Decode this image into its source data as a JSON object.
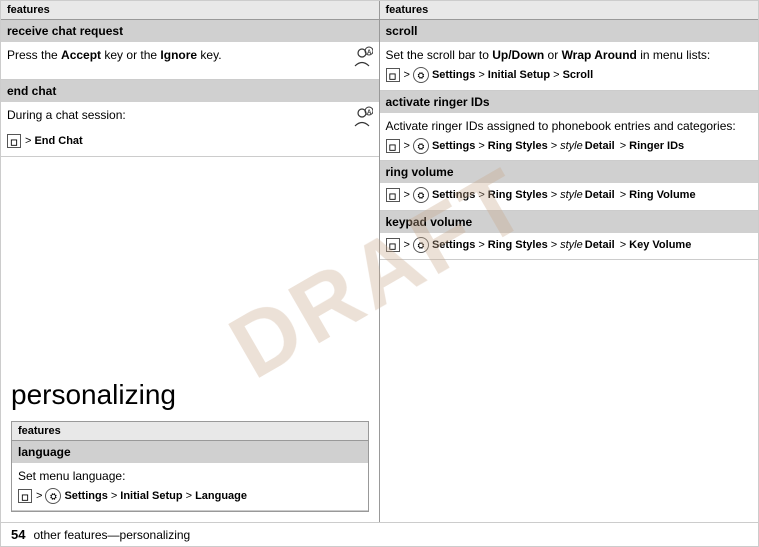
{
  "watermark": "DRAFT",
  "left_top": {
    "header": "features",
    "rows": [
      {
        "title": "receive chat request",
        "body_text": "Press the ",
        "body_bold1": "Accept",
        "body_mid": " key or the ",
        "body_bold2": "Ignore",
        "body_end": " key.",
        "has_icon": true
      },
      {
        "title": "end chat",
        "body_text": "During a chat session:",
        "has_icon": true,
        "menu": [
          {
            "type": "square-icon",
            "label": ""
          },
          {
            "type": "arrow",
            "label": ">"
          },
          {
            "type": "text-bold",
            "label": "End Chat"
          }
        ]
      }
    ]
  },
  "personalizing": {
    "title": "personalizing",
    "mini_table": {
      "header": "features",
      "rows": [
        {
          "title": "language",
          "body_text": "Set menu language:",
          "menu_path": "m > Settings > Initial Setup > Language"
        }
      ]
    }
  },
  "right_top": {
    "header": "features",
    "rows": [
      {
        "title": "scroll",
        "body_text": "Set the scroll bar to ",
        "body_bold1": "Up/Down",
        "body_mid": " or ",
        "body_bold2": "Wrap Around",
        "body_end": " in menu lists:",
        "menu_path": "m > Settings > Initial Setup > Scroll"
      },
      {
        "title": "activate ringer IDs",
        "body_text": "Activate ringer IDs assigned to phonebook entries and categories:",
        "menu_path": "m > Settings > Ring Styles > style Detail > Ringer IDs"
      },
      {
        "title": "ring volume",
        "menu_path": "m > Settings > Ring Styles > style Detail > Ring Volume"
      },
      {
        "title": "keypad volume",
        "menu_path": "m > Settings > Ring Styles > style Detail > Key Volume"
      }
    ]
  },
  "footer": {
    "page_number": "54",
    "text": "other features—personalizing"
  }
}
